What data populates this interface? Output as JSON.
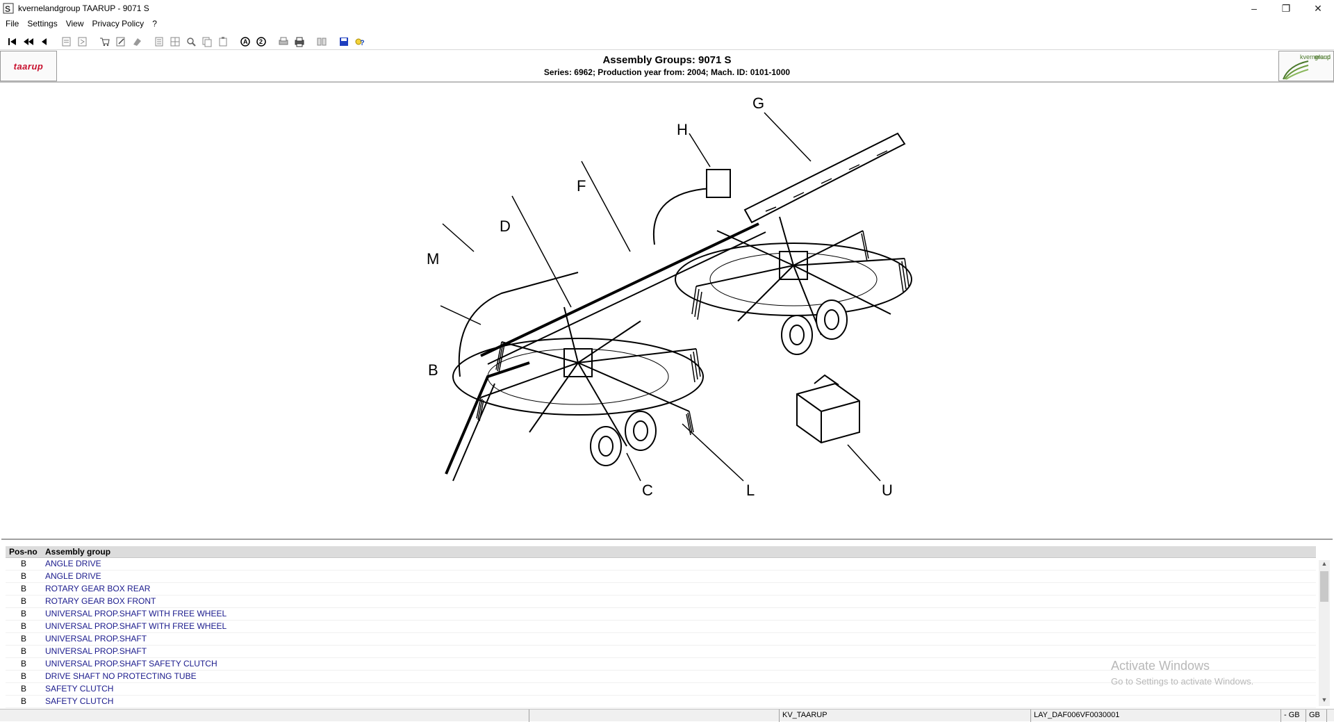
{
  "window": {
    "title": "kvernelandgroup TAARUP - 9071 S",
    "minimize": "–",
    "restore": "❐",
    "close": "✕"
  },
  "menu": [
    "File",
    "Settings",
    "View",
    "Privacy Policy",
    "?"
  ],
  "toolbar": {
    "icons": [
      "first-icon",
      "previous-fast-icon",
      "previous-icon",
      "page-back-icon",
      "page-forward-icon",
      "cart-icon",
      "edit-icon",
      "clear-icon",
      "list-icon",
      "grid-icon",
      "zoom-icon",
      "copy-icon",
      "paste-icon",
      "search-a-icon",
      "search-2-icon",
      "print-preview-icon",
      "print-icon",
      "book-icon",
      "save-icon",
      "help-icon"
    ]
  },
  "header": {
    "brand_left": "taarup",
    "brand_right_line1": "kverneland",
    "brand_right_line2": "group",
    "title": "Assembly Groups: 9071 S",
    "subtitle": "Series: 6962; Production year from: 2004; Mach. ID: 0101-1000"
  },
  "drawing": {
    "callouts": [
      "G",
      "H",
      "F",
      "D",
      "M",
      "B",
      "C",
      "L",
      "U"
    ]
  },
  "table": {
    "columns": [
      "Pos-no",
      "Assembly group"
    ],
    "rows": [
      {
        "pos": "B",
        "group": "ANGLE DRIVE"
      },
      {
        "pos": "B",
        "group": "ANGLE DRIVE"
      },
      {
        "pos": "B",
        "group": "ROTARY GEAR BOX REAR"
      },
      {
        "pos": "B",
        "group": "ROTARY GEAR BOX FRONT"
      },
      {
        "pos": "B",
        "group": "UNIVERSAL PROP.SHAFT WITH FREE WHEEL"
      },
      {
        "pos": "B",
        "group": "UNIVERSAL PROP.SHAFT WITH FREE WHEEL"
      },
      {
        "pos": "B",
        "group": "UNIVERSAL PROP.SHAFT"
      },
      {
        "pos": "B",
        "group": "UNIVERSAL PROP.SHAFT"
      },
      {
        "pos": "B",
        "group": "UNIVERSAL PROP.SHAFT SAFETY CLUTCH"
      },
      {
        "pos": "B",
        "group": "DRIVE SHAFT NO PROTECTING TUBE"
      },
      {
        "pos": "B",
        "group": "SAFETY CLUTCH"
      },
      {
        "pos": "B",
        "group": "SAFETY CLUTCH"
      }
    ]
  },
  "watermark": {
    "line1": "Activate Windows",
    "line2": "Go to Settings to activate Windows."
  },
  "status": {
    "cell1": "",
    "cell2": "",
    "cell3": "KV_TAARUP",
    "cell4": "LAY_DAF006VF0030001",
    "cell5": "- GB",
    "cell6": "GB"
  }
}
